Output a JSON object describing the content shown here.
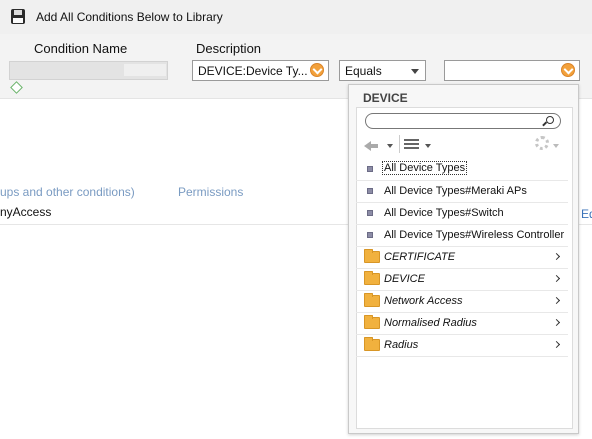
{
  "toolbar": {
    "save_icon": "floppy-disk-icon",
    "add_all_label": "Add All Conditions Below to Library"
  },
  "condition": {
    "name_header": "Condition Name",
    "description_header": "Description",
    "name_value": "",
    "attribute_value": "DEVICE:Device Ty...",
    "operator_value": "Equals",
    "value_field": ""
  },
  "background": {
    "truncated_link": "ups and other conditions)",
    "permissions_header": "Permissions",
    "row_text": "nyAccess",
    "edit_link": "Ed"
  },
  "popup": {
    "title": "DEVICE",
    "search_placeholder": "",
    "items": [
      {
        "label": "All Device Types",
        "type": "value",
        "icon": "bullet-icon",
        "selected": true
      },
      {
        "label": "All Device Types#Meraki APs",
        "type": "value",
        "icon": "bullet-icon"
      },
      {
        "label": "All Device Types#Switch",
        "type": "value",
        "icon": "bullet-icon"
      },
      {
        "label": "All Device Types#Wireless Controller",
        "type": "value",
        "icon": "bullet-icon"
      },
      {
        "label": "CERTIFICATE",
        "type": "folder",
        "icon": "folder-icon"
      },
      {
        "label": "DEVICE",
        "type": "folder",
        "icon": "folder-icon"
      },
      {
        "label": "Network Access",
        "type": "folder",
        "icon": "folder-icon"
      },
      {
        "label": "Normalised Radius",
        "type": "folder",
        "icon": "folder-icon"
      },
      {
        "label": "Radius",
        "type": "folder",
        "icon": "folder-icon"
      }
    ]
  },
  "colors": {
    "accent_orange": "#f3a13b",
    "link_blue": "#3b73b9",
    "folder_yellow": "#f1b13e"
  }
}
